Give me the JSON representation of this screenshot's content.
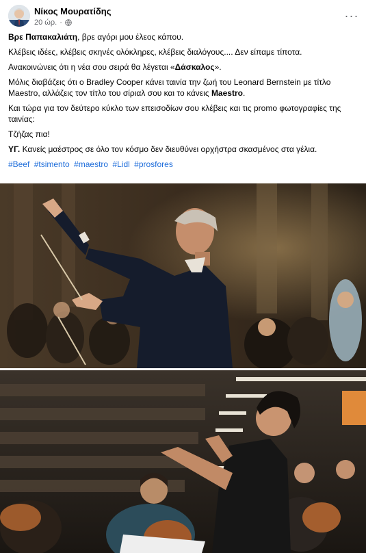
{
  "post": {
    "author": "Νίκος Μουρατίδης",
    "time": "20 ώρ.",
    "separator": "·",
    "privacy_icon": "globe-icon",
    "more_icon": "more-horizontal-icon",
    "body": {
      "line1_bold": "Βρε Παπακαλιάτη",
      "line1_rest": ", βρε αγόρι μου έλεος κάπου.",
      "line2": "Κλέβεις ιδέες, κλέβεις σκηνές ολόκληρες, κλέβεις διαλόγους.... Δεν είπαμε τίποτα.",
      "line3_pre": "Ανακοινώνεις ότι η νέα σου σειρά θα λέγεται «",
      "line3_bold": "Δάσκαλος",
      "line3_post": "».",
      "line4_pre": "Μόλις διαβάζεις ότι ο Bradley Cooper κάνει ταινία την ζωή του Leonard Bernstein με τίτλο Maestro, αλλάζεις τον τίτλο του σίριαλ σου και το κάνεις ",
      "line4_bold": "Maestro",
      "line4_post": ".",
      "line5": "Και τώρα για τον δεύτερο κύκλο των επεισοδίων σου κλέβεις και τις promo φωτογραφίες της ταινίας:",
      "line6": "Τζήζας πια!",
      "line7_bold": "ΥΓ.",
      "line7_rest": " Κανείς μαέστρος σε όλο τον κόσμο δεν διευθύνει ορχήστρα σκασμένος στα γέλια."
    },
    "hashtags": [
      "#Beef",
      "#tsimento",
      "#maestro",
      "#Lidl",
      "#prosfores"
    ]
  },
  "colors": {
    "link": "#216fdb",
    "secondary_text": "#65676b"
  }
}
